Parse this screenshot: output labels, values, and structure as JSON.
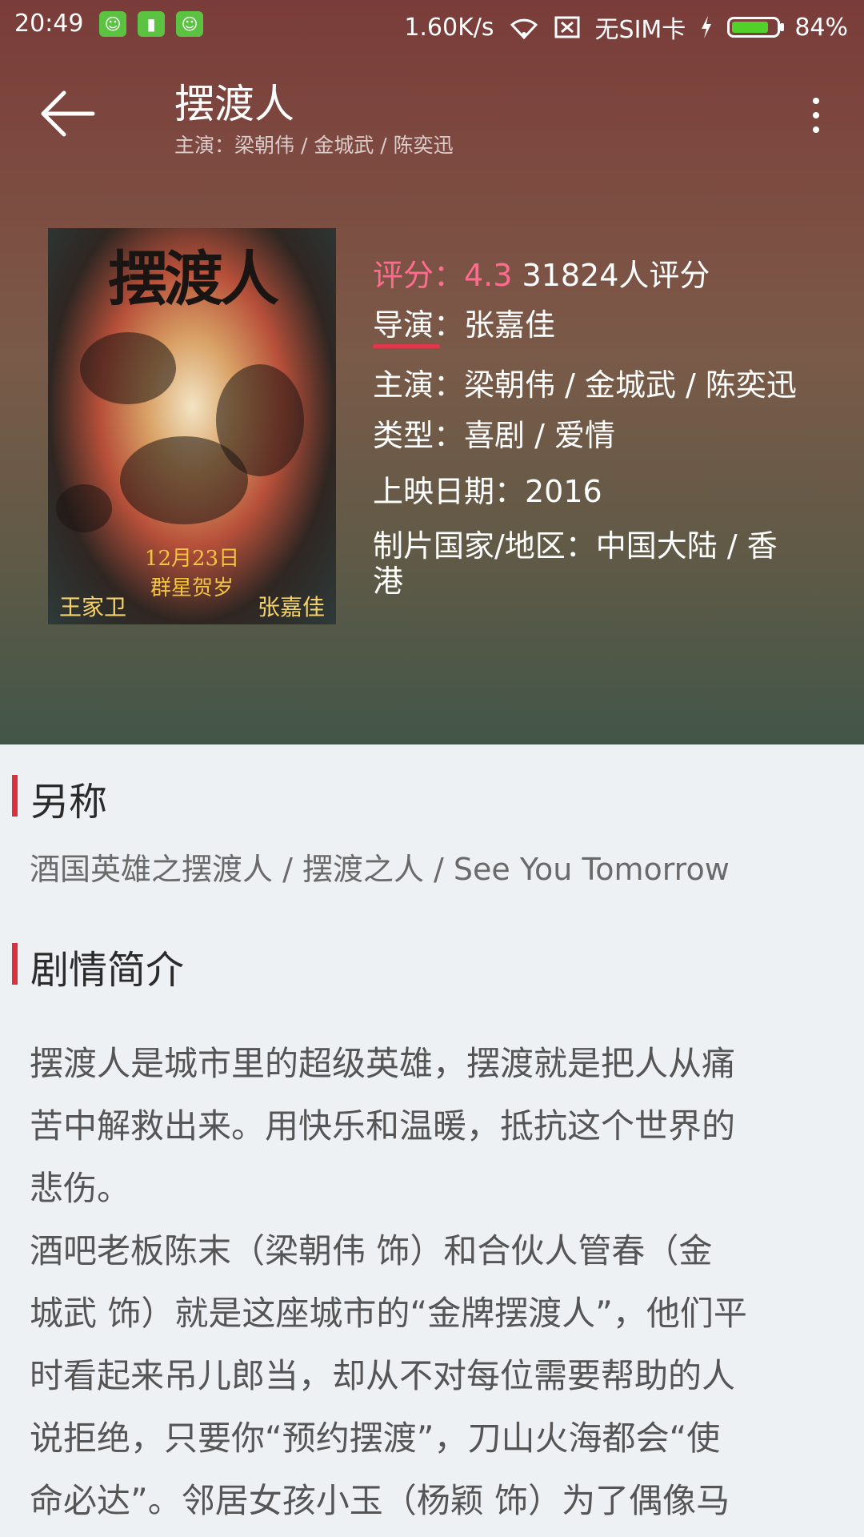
{
  "status_bar": {
    "time": "20:49",
    "network_speed": "1.60K/s",
    "sim": "无SIM卡",
    "battery": "84%",
    "battery_level": 0.84
  },
  "toolbar": {
    "title": "摆渡人",
    "subtitle": "主演：梁朝伟 / 金城武 / 陈奕迅"
  },
  "poster": {
    "title_text": "摆渡人",
    "date_text": "12月23日",
    "promo_text": "群星贺岁",
    "left_credit": "王家卫",
    "right_credit": "张嘉佳"
  },
  "info": {
    "rating_label": "评分：4.3",
    "rating_count": "31824人评分",
    "director": "导演：张嘉佳",
    "cast": "主演：梁朝伟 / 金城武 / 陈奕迅",
    "genre": "类型：喜剧 / 爱情",
    "release": "上映日期：2016",
    "country_line1": "制片国家/地区：中国大陆 / 香",
    "country_line2": "港"
  },
  "sections": {
    "aka_title": "另称",
    "aka_text": "酒国英雄之摆渡人 / 摆渡之人 / See You Tomorrow",
    "synopsis_title": "剧情简介",
    "synopsis_lines": [
      "摆渡人是城市里的超级英雄，摆渡就是把人从痛",
      "苦中解救出来。用快乐和温暖，抵抗这个世界的",
      "悲伤。",
      "酒吧老板陈末（梁朝伟 饰）和合伙人管春（金",
      "城武 饰）就是这座城市的“金牌摆渡人”，他们平",
      "时看起来吊儿郎当，却从不对每位需要帮助的人",
      "说拒绝，只要你“预约摆渡”，刀山火海都会“使",
      "命必达”。邻居女孩小玉（杨颖 饰）为了偶像马"
    ]
  }
}
